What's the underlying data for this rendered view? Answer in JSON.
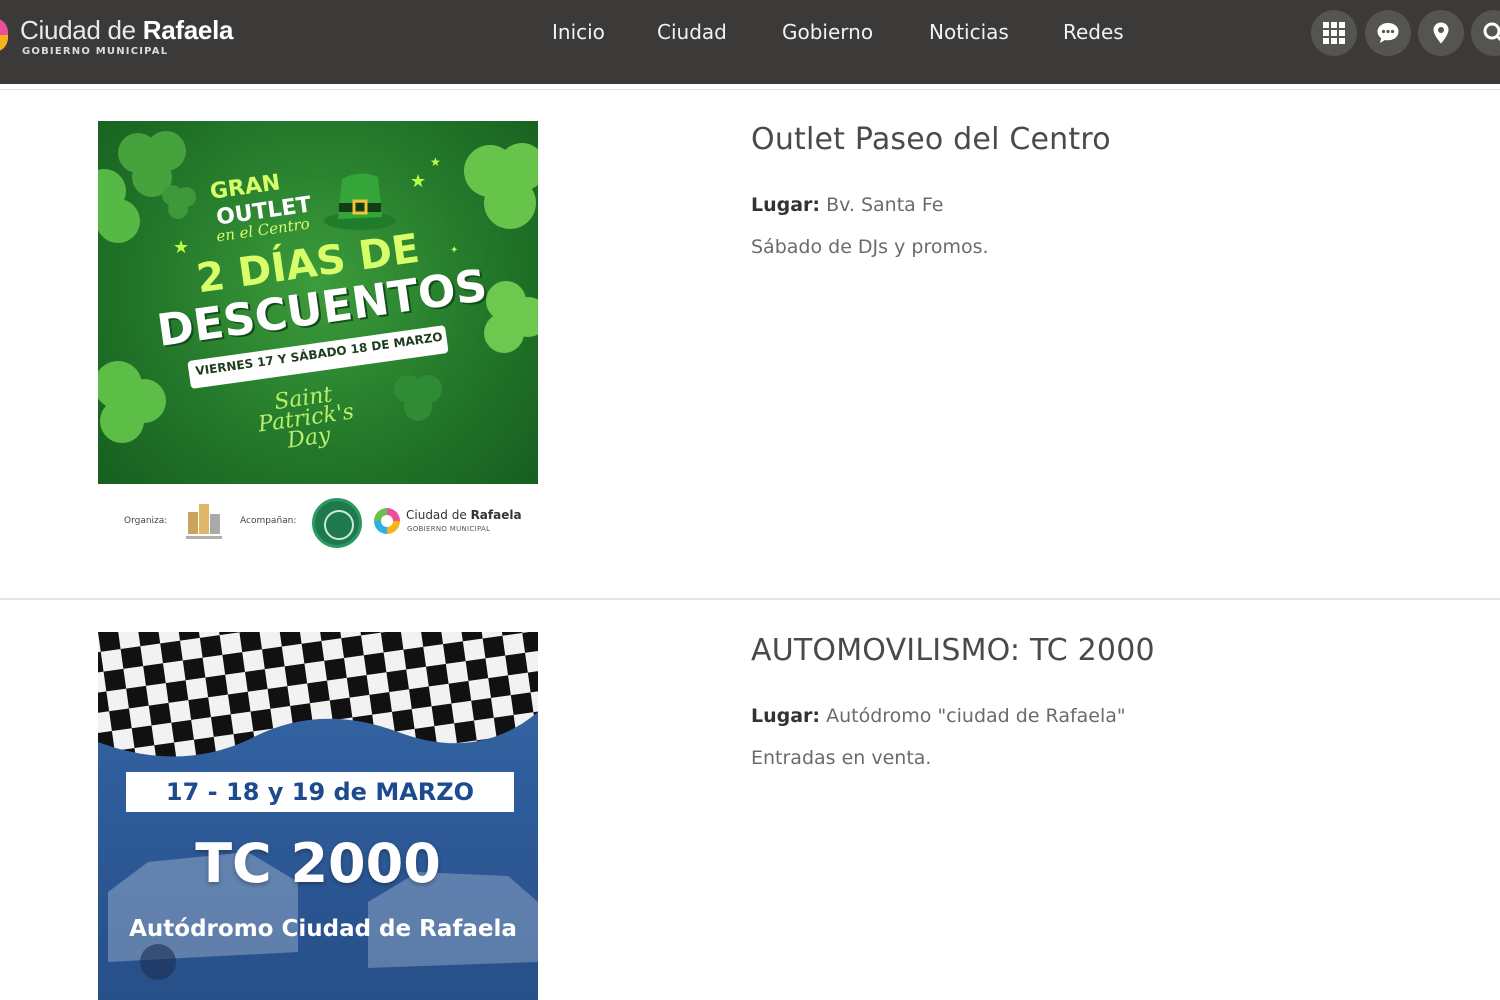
{
  "header": {
    "logo_title_regular": "Ciudad de",
    "logo_title_bold": "Rafaela",
    "logo_subtitle": "GOBIERNO MUNICIPAL",
    "nav": [
      {
        "label": "Inicio"
      },
      {
        "label": "Ciudad"
      },
      {
        "label": "Gobierno"
      },
      {
        "label": "Noticias"
      },
      {
        "label": "Redes"
      }
    ],
    "icons": [
      "apps-grid-icon",
      "chat-bubble-icon",
      "map-pin-icon",
      "search-icon"
    ]
  },
  "events": [
    {
      "title": "Outlet Paseo del Centro",
      "place_label": "Lugar:",
      "place": "Bv. Santa Fe",
      "description": "Sábado de DJs y promos.",
      "flyer": {
        "gran": "GRAN",
        "outlet": "OUTLET",
        "centro": "en el Centro",
        "dias": "2 DÍAS DE",
        "descuentos": "DESCUENTOS",
        "dates": "VIERNES 17 Y SÁBADO 18 DE MARZO",
        "saint_line1": "Saint",
        "saint_line2": "Patrick's",
        "saint_line3": "Day",
        "organiza": "Organiza:",
        "acompanan": "Acompañan:",
        "city_regular": "Ciudad de",
        "city_bold": "Rafaela",
        "city_sub": "GOBIERNO MUNICIPAL",
        "colors": {
          "green_dark": "#175e20",
          "green": "#23782a",
          "lime": "#d8ff6a"
        }
      }
    },
    {
      "title": "AUTOMOVILISMO: TC 2000",
      "place_label": "Lugar:",
      "place": "Autódromo \"ciudad de Rafaela\"",
      "description": "Entradas en venta.",
      "flyer": {
        "dates": "17 - 18 y 19 de MARZO",
        "headline": "TC 2000",
        "venue": "Autódromo Ciudad de Rafaela",
        "colors": {
          "blue": "#2f5d9c",
          "navy": "#1d4b8f"
        }
      }
    }
  ],
  "colors": {
    "header_bg": "#3b3a38",
    "header_button": "#55544f"
  }
}
